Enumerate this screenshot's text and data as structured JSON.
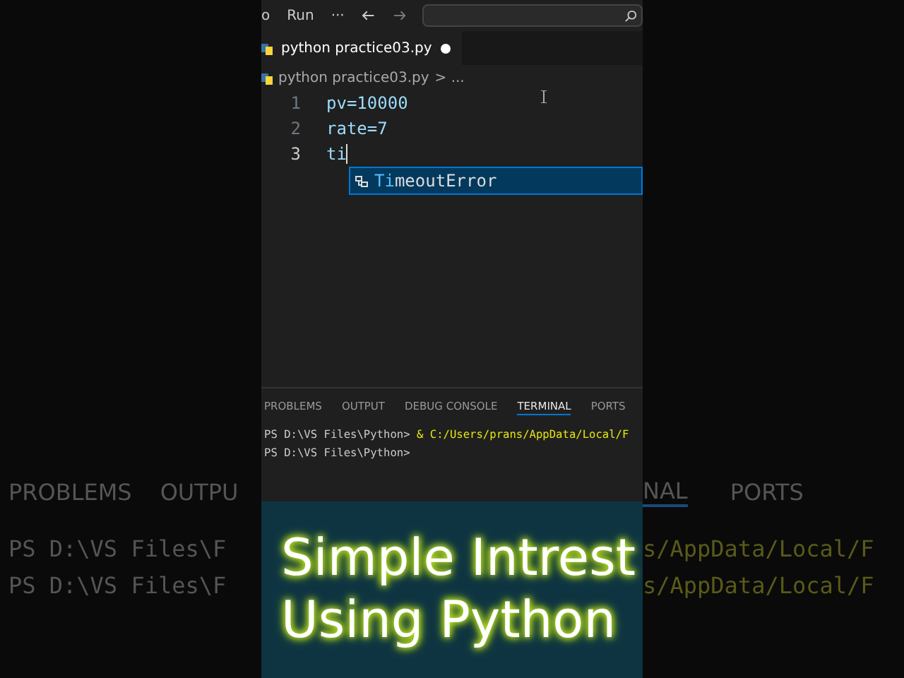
{
  "backdrop": {
    "left_tabs": [
      "PROBLEMS",
      "OUTPU"
    ],
    "right_tabs": [
      "NAL",
      "PORTS"
    ],
    "left_lines": [
      "PS D:\\VS Files\\F",
      "PS D:\\VS Files\\F"
    ],
    "right_lines": [
      "s/AppData/Local/F",
      "s/AppData/Local/F"
    ]
  },
  "menu": [
    "o",
    "Run",
    "···"
  ],
  "tab": {
    "label": "python practice03.py",
    "modified": true
  },
  "breadcrumb": {
    "file": "python practice03.py",
    "rest": "> ..."
  },
  "code_lines": [
    {
      "number": "1",
      "text": "pv=10000",
      "kind": "assign"
    },
    {
      "number": "2",
      "text": "rate=7",
      "kind": "assign"
    },
    {
      "number": "3",
      "text": "ti",
      "kind": "typing"
    }
  ],
  "suggestion": {
    "match": "Ti",
    "rest": "meoutError"
  },
  "panel_tabs": [
    {
      "label": "PROBLEMS",
      "selected": false
    },
    {
      "label": "OUTPUT",
      "selected": false
    },
    {
      "label": "DEBUG CONSOLE",
      "selected": false
    },
    {
      "label": "TERMINAL",
      "selected": true
    },
    {
      "label": "PORTS",
      "selected": false
    }
  ],
  "terminal": [
    {
      "prompt": "PS D:\\VS Files\\Python>",
      "command": "& C:/Users/prans/AppData/Local/F"
    },
    {
      "prompt": "PS D:\\VS Files\\Python>"
    }
  ],
  "caption": [
    "Simple Intrest",
    "Using Python"
  ]
}
